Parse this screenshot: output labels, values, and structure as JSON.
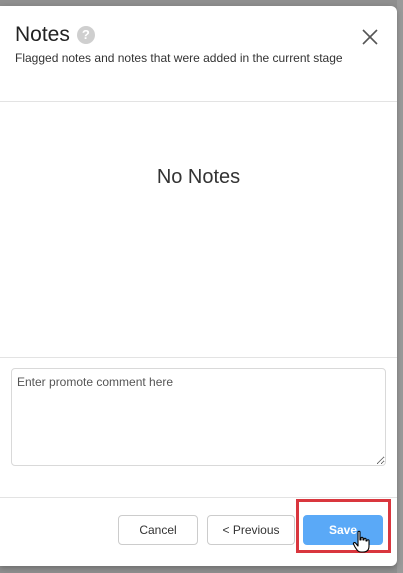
{
  "dialog": {
    "title": "Notes",
    "subtitle": "Flagged notes and notes that were added in the current stage",
    "help_icon": "question-icon",
    "close_icon": "close-icon"
  },
  "notes": {
    "items": [],
    "empty_text": "No Notes"
  },
  "comment": {
    "value": "",
    "placeholder": "Enter promote comment here"
  },
  "footer": {
    "cancel_label": "Cancel",
    "previous_label": "< Previous",
    "save_label": "Save"
  },
  "colors": {
    "primary": "#5aa9f7",
    "highlight": "#d9363e"
  }
}
